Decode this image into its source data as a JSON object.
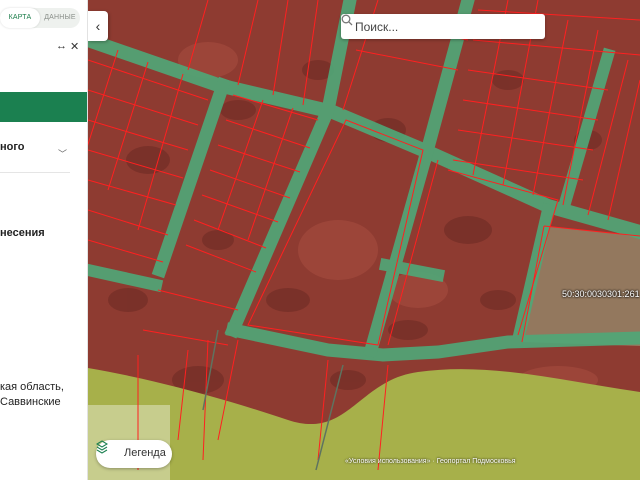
{
  "panel": {
    "tabs": [
      {
        "label": "Карта",
        "active": true
      },
      {
        "label": "Данные",
        "active": false
      }
    ],
    "expand_icon": "double-arrow-icon",
    "close_icon": "close-icon",
    "accent_color": "#1b8050",
    "section_fragment": "ного",
    "row_fragment": "несения",
    "address_line1": "кая область,",
    "address_line2": "Саввинские"
  },
  "map": {
    "search_placeholder": "Поиск...",
    "parcel_label": "50:30:0030301:261",
    "legend_label": "Легенда",
    "attribution": "«Условия использования» · Геопортал Подмосковья",
    "colors": {
      "parcel_fill": "#9c3a32",
      "road_fill": "#4fa878",
      "boundary": "#ff2020",
      "forest_zone": "#a7b04a"
    }
  }
}
